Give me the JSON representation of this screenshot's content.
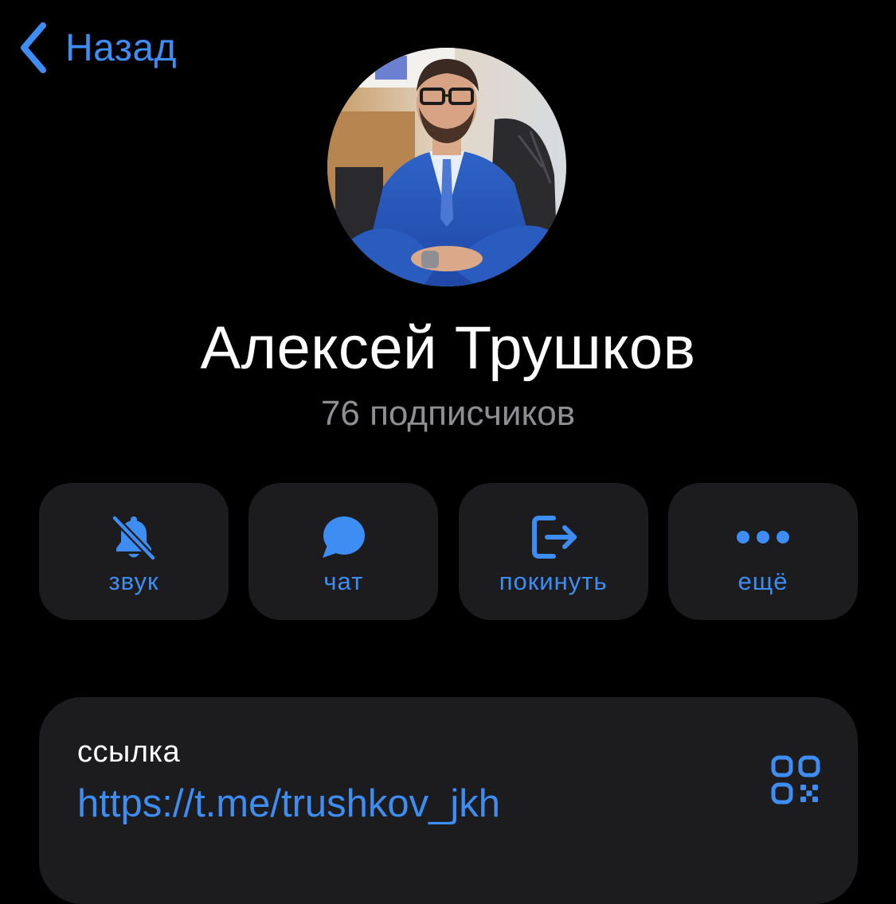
{
  "nav": {
    "back_label": "Назад",
    "back_icon": "chevron-left-icon"
  },
  "profile": {
    "name": "Алексей Трушков",
    "subscribers": "76 подписчиков",
    "avatar": "avatar-photo"
  },
  "actions": [
    {
      "label": "звук",
      "icon": "bell-slash-icon"
    },
    {
      "label": "чат",
      "icon": "chat-bubble-icon"
    },
    {
      "label": "покинуть",
      "icon": "leave-icon"
    },
    {
      "label": "ещё",
      "icon": "more-dots-icon"
    }
  ],
  "link_card": {
    "label": "ссылка",
    "url": "https://t.me/trushkov_jkh",
    "qr_icon": "qr-code-icon"
  },
  "colors": {
    "background": "#000000",
    "surface": "#1c1c1e",
    "accent": "#3e8df3",
    "secondary_text": "#8e8e93",
    "primary_text": "#ffffff"
  }
}
